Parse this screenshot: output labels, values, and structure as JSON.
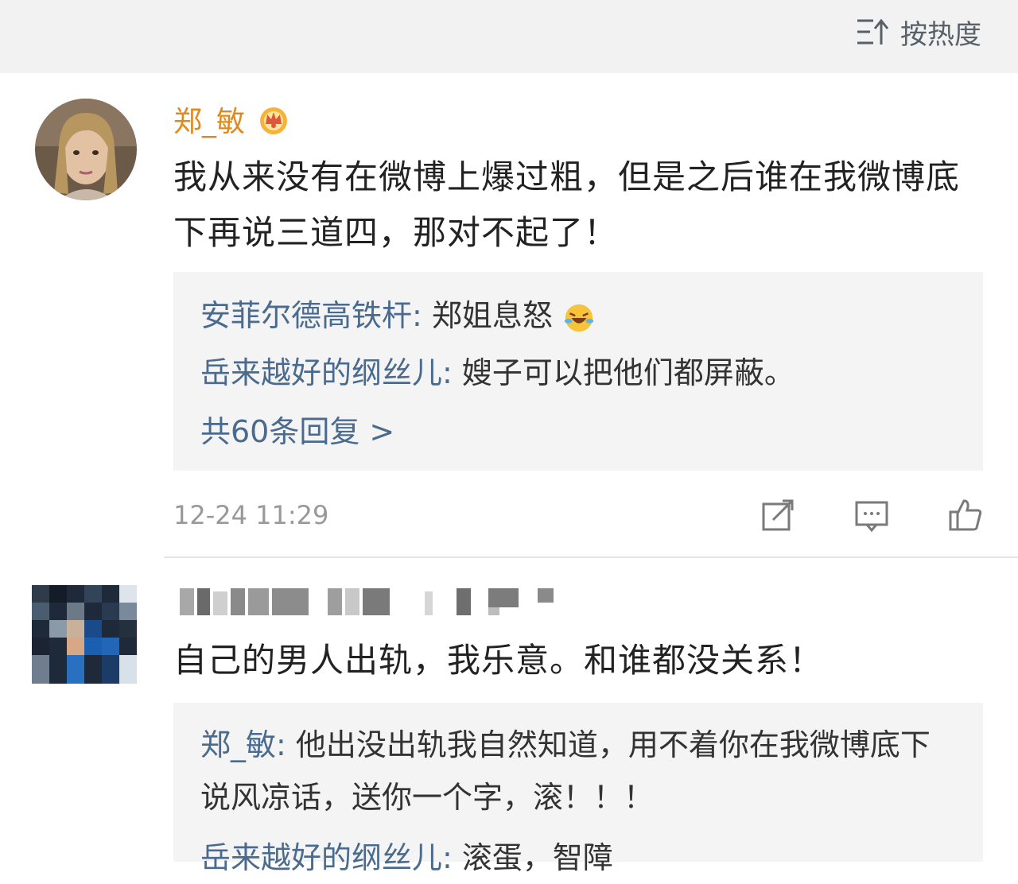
{
  "header": {
    "sort_label": "按热度"
  },
  "comment1": {
    "author": "郑_敏",
    "text": "我从来没有在微博上爆过粗，但是之后谁在我微博底下再说三道四，那对不起了！",
    "replies": [
      {
        "name": "安菲尔德高铁杆:",
        "text": " 郑姐息怒"
      },
      {
        "name": "岳来越好的纲丝儿:",
        "text": " 嫂子可以把他们都屏蔽。"
      }
    ],
    "more_replies": "共60条回复 >",
    "time": "12-24 11:29"
  },
  "comment2": {
    "text": "自己的男人出轨，我乐意。和谁都没关系！",
    "replies": [
      {
        "name": "郑_敏:",
        "text": " 他出没出轨我自然知道，用不着你在我微博底下说风凉话，送你一个字，滚！！！"
      },
      {
        "name": "岳来越好的纲丝儿:",
        "text": " 滚蛋，智障"
      }
    ]
  },
  "colors": {
    "author": "#e08a1e",
    "reply_name": "#4a6a8e",
    "reply_bg": "#f4f4f4"
  }
}
